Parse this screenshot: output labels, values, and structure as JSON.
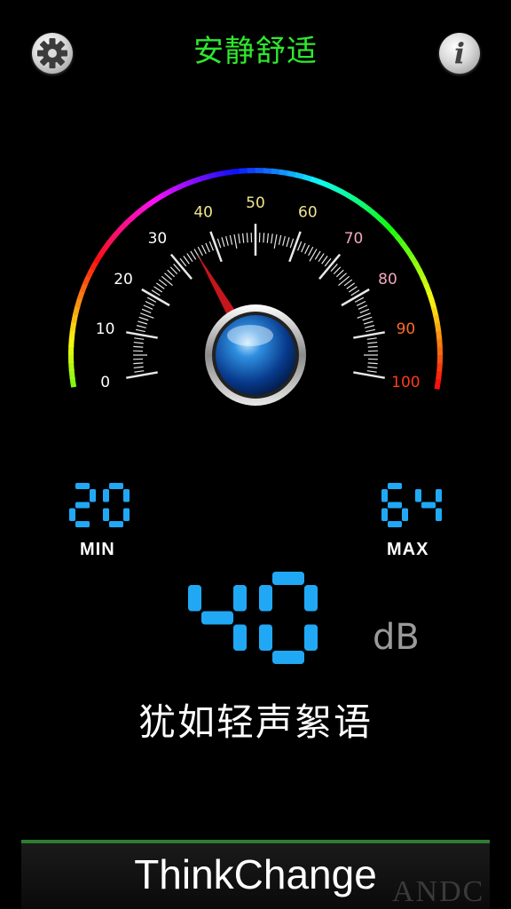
{
  "header": {
    "title": "安静舒适",
    "title_color": "#2ee82e",
    "settings_icon": "gear-icon",
    "info_icon": "info-icon",
    "info_glyph": "i"
  },
  "gauge": {
    "min": 0,
    "max": 100,
    "labels": [
      "0",
      "10",
      "20",
      "30",
      "40",
      "50",
      "60",
      "70",
      "80",
      "90",
      "100"
    ],
    "needle_value": 35,
    "label_colors": [
      "#ffffff",
      "#ffffff",
      "#ffffff",
      "#ffffff",
      "#f0e68c",
      "#f0e68c",
      "#f0e68c",
      "#f4a6c4",
      "#f4a6c4",
      "#ff6a2a",
      "#ff3a1a"
    ]
  },
  "readouts": {
    "min_value": "20",
    "min_label": "MIN",
    "max_value": "64",
    "max_label": "MAX",
    "current_value": "40",
    "unit": "dB",
    "digit_color": "#21a8f5"
  },
  "status": {
    "description": "犹如轻声絮语"
  },
  "footer": {
    "brand": "ThinkChange",
    "watermark": "ANDC"
  }
}
